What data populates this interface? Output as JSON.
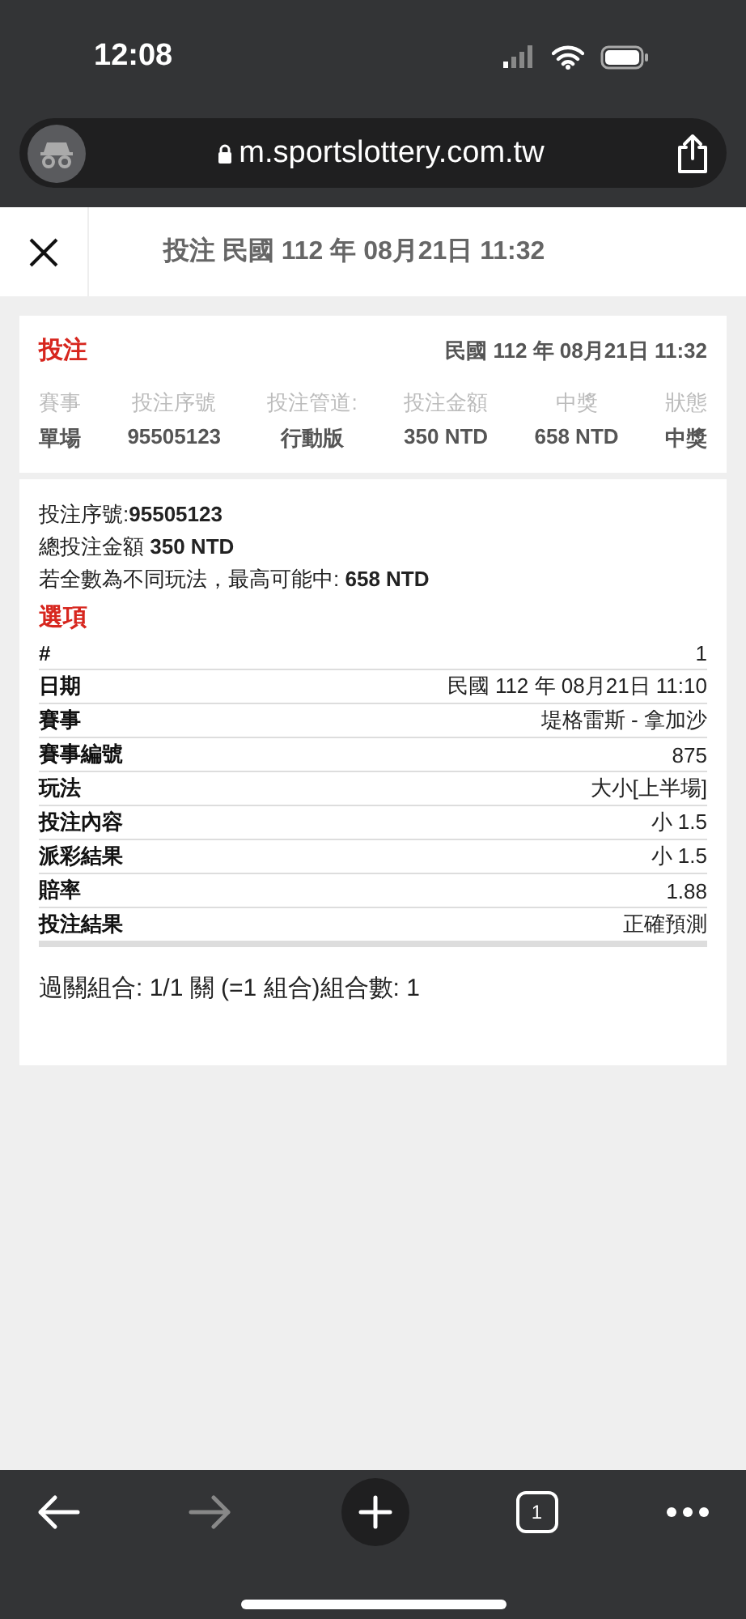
{
  "status_bar": {
    "time": "12:08"
  },
  "browser": {
    "url": "m.sportslottery.com.tw"
  },
  "header": {
    "title": "投注 民國 112 年 08月21日 11:32"
  },
  "summary": {
    "title": "投注",
    "date": "民國 112 年 08月21日 11:32",
    "columns": [
      {
        "label": "賽事",
        "value": "單場"
      },
      {
        "label": "投注序號",
        "value": "95505123"
      },
      {
        "label": "投注管道:",
        "value": "行動版"
      },
      {
        "label": "投注金額",
        "value": "350 NTD"
      },
      {
        "label": "中獎",
        "value": "658 NTD"
      },
      {
        "label": "狀態",
        "value": "中獎"
      }
    ]
  },
  "detail": {
    "lines": [
      "投注序號:**95505123**",
      "總投注金額 **350 NTD**",
      "若全數為不同玩法，最高可能中: **658 NTD**"
    ],
    "section_title": "選項",
    "rows": [
      {
        "label": "#",
        "value": "1"
      },
      {
        "label": "日期",
        "value": "民國 112 年 08月21日 11:10"
      },
      {
        "label": "賽事",
        "value": "堤格雷斯 - 拿加沙"
      },
      {
        "label": "賽事編號",
        "value": "875"
      },
      {
        "label": "玩法",
        "value": "大小[上半場]"
      },
      {
        "label": "投注內容",
        "value": "小 1.5"
      },
      {
        "label": "派彩結果",
        "value": "小 1.5"
      },
      {
        "label": "賠率",
        "value": "1.88"
      },
      {
        "label": "投注結果",
        "value": "正確預測"
      }
    ],
    "combination": "過關組合: 1/1 關 (=1 組合)組合數: 1"
  },
  "toolbar": {
    "back_disabled": false,
    "forward_disabled": true,
    "tab_count": "1"
  }
}
